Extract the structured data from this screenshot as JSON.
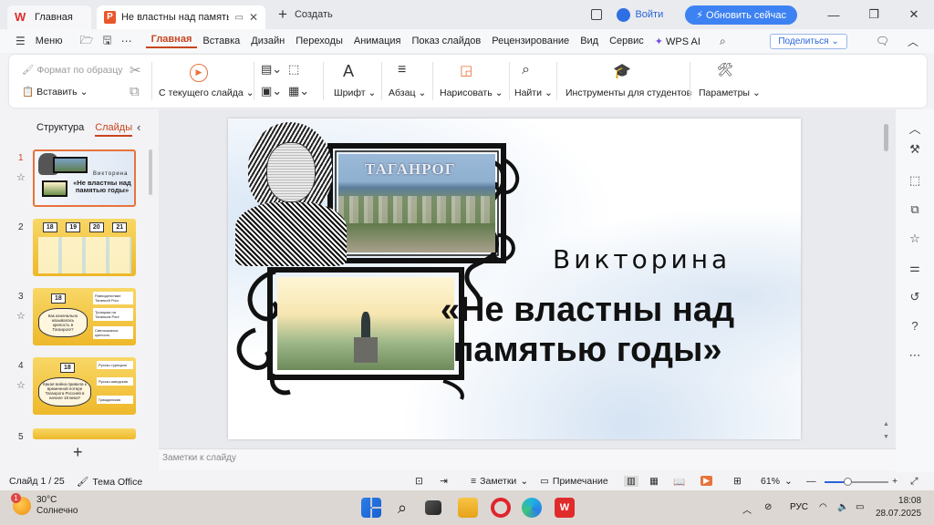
{
  "titlebar": {
    "home_tab": "Главная",
    "doc_tab": "Не властны над памятью го,",
    "new_tab": "Создать",
    "login": "Войти",
    "upgrade": "Обновить сейчас"
  },
  "menubar": {
    "menu": "Меню",
    "items": [
      "Главная",
      "Вставка",
      "Дизайн",
      "Переходы",
      "Анимация",
      "Показ слайдов",
      "Рецензирование",
      "Вид",
      "Сервис",
      "WPS AI"
    ],
    "share": "Поделиться"
  },
  "ribbon": {
    "format_painter": "Формат по образцу",
    "paste": "Вставить",
    "from_current": "С текущего слайда",
    "font": "Шрифт",
    "paragraph": "Абзац",
    "draw": "Нарисовать",
    "find": "Найти",
    "student_tools": "Инструменты для студентов",
    "parameters": "Параметры"
  },
  "left_panel": {
    "tab_structure": "Структура",
    "tab_slides": "Слайды",
    "slide_numbers": [
      "1",
      "2",
      "3",
      "4",
      "5"
    ]
  },
  "slide": {
    "caption": "ТАГАНРОГ",
    "subtitle": "Викторина",
    "title_line1": "«Не властны над",
    "title_line2": "памятью годы»"
  },
  "thumbs": {
    "t1_sub": "Викторина",
    "t1_title": "«Не властны над памятью годы»",
    "t2_cols": [
      "18",
      "19",
      "20",
      "21"
    ],
    "t3_num": "18",
    "t3_q": "Как изначально называлась крепость в Таганроге?",
    "t3_a1": "Равноденствие Таганьей Рогз",
    "t3_a2": "Троицкая на Таганьем Роге",
    "t3_a3": "Святоказачья крепость",
    "t4_num": "18",
    "t4_q": "Какая война привела к временной потере Таганрога Россией в начале 18 века?",
    "t4_a1": "Русско-турецкая",
    "t4_a2": "Русско-шведская",
    "t4_a3": "Гражданская"
  },
  "notes_placeholder": "Заметки к слайду",
  "status": {
    "slide_counter": "Слайд 1 / 25",
    "theme": "Тема Office",
    "notes": "Заметки",
    "comment": "Примечание",
    "zoom": "61%",
    "zoom_fraction": 0.35
  },
  "taskbar": {
    "temperature": "30°C",
    "weather": "Солнечно",
    "badge": "1",
    "lang": "РУС",
    "time": "18:08",
    "date": "28.07.2025"
  },
  "colors": {
    "accent": "#c8451f",
    "upgrade_btn": "#3d82f2",
    "thumb_yellow": "#f3c53a"
  }
}
